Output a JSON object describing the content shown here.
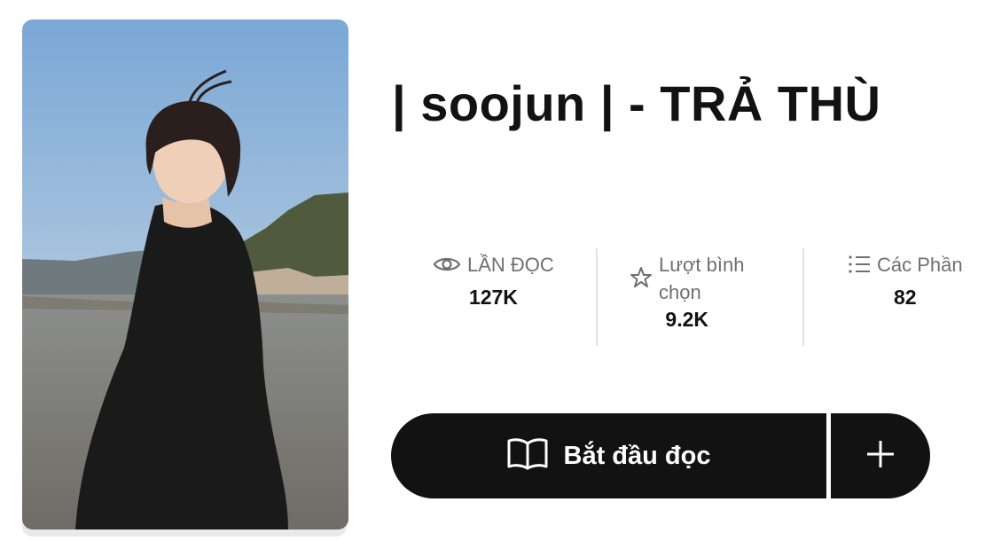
{
  "story": {
    "title": "| soojun | - TRẢ THÙ",
    "cover_alt": "Story cover image"
  },
  "stats": {
    "reads": {
      "label": "LẦN ĐỌC",
      "value": "127K",
      "icon": "eye-icon"
    },
    "votes": {
      "label_line1": "Lượt bình",
      "label_line2": "chọn",
      "value": "9.2K",
      "icon": "star-icon"
    },
    "parts": {
      "label": "Các Phần",
      "value": "82",
      "icon": "list-icon"
    }
  },
  "actions": {
    "start_reading_label": "Bắt đầu đọc",
    "add_to_library_icon": "plus-icon"
  },
  "colors": {
    "button_bg": "#121212",
    "title": "#121212",
    "stat_label": "#6f6f6f",
    "divider": "#e2e2e2"
  }
}
